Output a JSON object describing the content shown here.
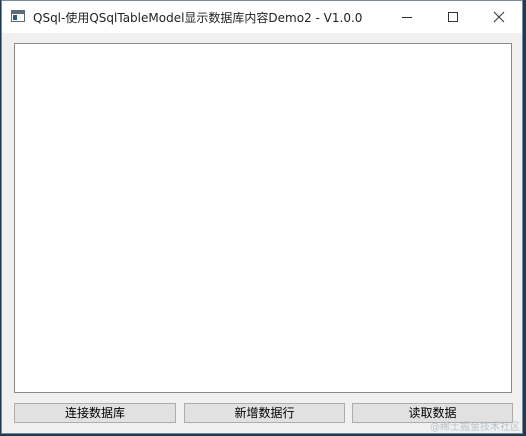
{
  "window": {
    "title": "QSql-使用QSqlTableModel显示数据库内容Demo2 - V1.0.0"
  },
  "buttons": {
    "connect_label": "连接数据库",
    "add_row_label": "新增数据行",
    "read_label": "读取数据"
  },
  "watermark": {
    "text": "@稀土掘金技术社区"
  },
  "icons": {
    "app": "window-app-icon",
    "minimize": "minimize-icon",
    "maximize": "maximize-icon",
    "close": "close-icon"
  },
  "colors": {
    "window_bg": "#f0f0f0",
    "button_bg": "#e1e1e1",
    "button_border": "#adadad",
    "table_bg": "#ffffff"
  }
}
